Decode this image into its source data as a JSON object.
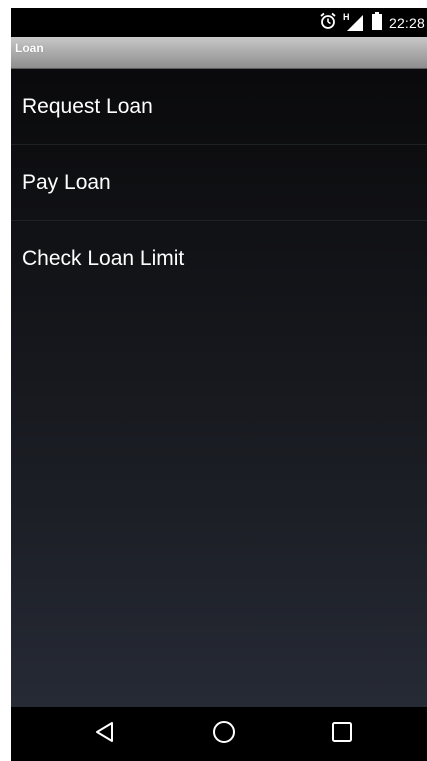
{
  "status_bar": {
    "time": "22:28",
    "icons": [
      "alarm-icon",
      "signal-icon",
      "battery-icon"
    ],
    "network_label": "H"
  },
  "title_bar": {
    "title": "Loan"
  },
  "menu": {
    "items": [
      {
        "label": "Request Loan"
      },
      {
        "label": "Pay Loan"
      },
      {
        "label": "Check Loan Limit"
      }
    ]
  },
  "nav_bar": {
    "buttons": [
      "back-icon",
      "home-icon",
      "recents-icon"
    ]
  },
  "colors": {
    "title_bar": "#a9a9a9",
    "background_top": "#0a0a0c",
    "background_bottom": "#262a35",
    "text": "#ffffff"
  }
}
